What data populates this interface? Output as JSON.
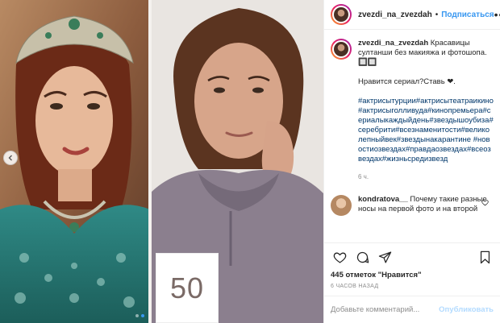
{
  "header": {
    "username": "zvezdi_na_zvezdah",
    "separator": "•",
    "follow_label": "Подписаться",
    "more_icon": "ellipsis-icon"
  },
  "caption": {
    "username": "zvezdi_na_zvezdah",
    "line1": "Красавицы султанши без макияжа и фотошопа. 🔲🔲",
    "line2": "Нравится сериал?Ставь ❤.",
    "hashtags": "#актрисытурции#актрисытеатраикино#актрисыголливуда#кинопремьера#сериалыкаждыйдень#звездышоубиза#серебрити#всезнаменитости#великолепныйвек#звездынакарантине #новостиозвездах#правдаозвездах#всеозвездах#жизньсредизвезд",
    "time": "6 ч."
  },
  "comment": {
    "username": "kondratova__",
    "text": "Почему такие разные носы на первой фото и на второй"
  },
  "actions": {
    "likes": "445 отметок \"Нравится\"",
    "time_ago": "6 ЧАСОВ НАЗАД"
  },
  "add_comment": {
    "placeholder": "Добавьте комментарий...",
    "publish_label": "Опубликовать"
  },
  "media": {
    "number_label": "50",
    "dots_count": 2,
    "active_dot": 1
  },
  "colors": {
    "accent": "#3897f0",
    "link": "#00376b",
    "muted": "#8e8e8e",
    "publish_disabled": "#b3dbff"
  }
}
